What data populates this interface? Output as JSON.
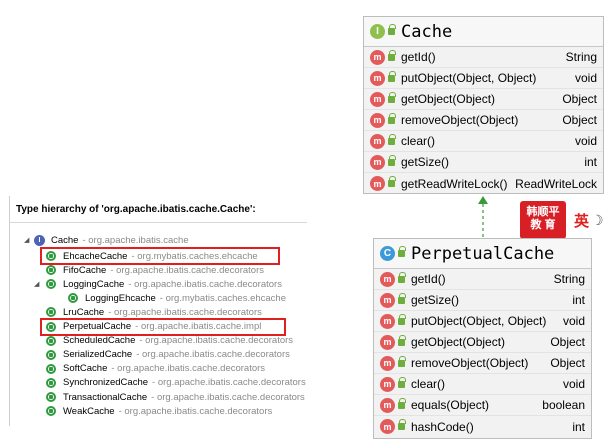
{
  "cache_box": {
    "badge": "I",
    "title": "Cache",
    "methods": [
      {
        "badge": "m",
        "name": "getId()",
        "type": "String"
      },
      {
        "badge": "m",
        "name": "putObject(Object, Object)",
        "type": "void"
      },
      {
        "badge": "m",
        "name": "getObject(Object)",
        "type": "Object"
      },
      {
        "badge": "m",
        "name": "removeObject(Object)",
        "type": "Object"
      },
      {
        "badge": "m",
        "name": "clear()",
        "type": "void"
      },
      {
        "badge": "m",
        "name": "getSize()",
        "type": "int"
      },
      {
        "badge": "m",
        "name": "getReadWriteLock()",
        "type": "ReadWriteLock"
      }
    ]
  },
  "perpetual_box": {
    "badge": "C",
    "title": "PerpetualCache",
    "methods": [
      {
        "badge": "m",
        "name": "getId()",
        "type": "String"
      },
      {
        "badge": "m",
        "name": "getSize()",
        "type": "int"
      },
      {
        "badge": "m",
        "name": "putObject(Object, Object)",
        "type": "void"
      },
      {
        "badge": "m",
        "name": "getObject(Object)",
        "type": "Object"
      },
      {
        "badge": "m",
        "name": "removeObject(Object)",
        "type": "Object"
      },
      {
        "badge": "m",
        "name": "clear()",
        "type": "void"
      },
      {
        "badge": "m",
        "name": "equals(Object)",
        "type": "boolean"
      },
      {
        "badge": "m",
        "name": "hashCode()",
        "type": "int"
      }
    ]
  },
  "hierarchy": {
    "title": "Type hierarchy of 'org.apache.ibatis.cache.Cache':",
    "root": {
      "name": "Cache",
      "package": "- org.apache.ibatis.cache"
    },
    "items": [
      {
        "name": "EhcacheCache",
        "package": "- org.mybatis.caches.ehcache",
        "highlighted": true
      },
      {
        "name": "FifoCache",
        "package": "- org.apache.ibatis.cache.decorators"
      },
      {
        "name": "LoggingCache",
        "package": "- org.apache.ibatis.cache.decorators",
        "expanded": true
      },
      {
        "name": "LoggingEhcache",
        "package": "- org.mybatis.caches.ehcache",
        "child": true
      },
      {
        "name": "LruCache",
        "package": "- org.apache.ibatis.cache.decorators"
      },
      {
        "name": "PerpetualCache",
        "package": "- org.apache.ibatis.cache.impl",
        "highlighted": true
      },
      {
        "name": "ScheduledCache",
        "package": "- org.apache.ibatis.cache.decorators"
      },
      {
        "name": "SerializedCache",
        "package": "- org.apache.ibatis.cache.decorators"
      },
      {
        "name": "SoftCache",
        "package": "- org.apache.ibatis.cache.decorators"
      },
      {
        "name": "SynchronizedCache",
        "package": "- org.apache.ibatis.cache.decorators"
      },
      {
        "name": "TransactionalCache",
        "package": "- org.apache.ibatis.cache.decorators"
      },
      {
        "name": "WeakCache",
        "package": "- org.apache.ibatis.cache.decorators"
      }
    ]
  },
  "logo": {
    "line1": "韩顺平",
    "line2": "教 育",
    "lang": "英"
  },
  "colors": {
    "highlight": "#e0201e",
    "class_icon": "#2f9a3e",
    "interface_icon": "#4e63b5",
    "method_badge": "#e35a5a"
  }
}
